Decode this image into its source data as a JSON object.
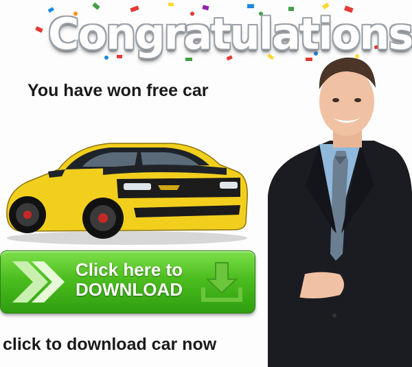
{
  "banner": {
    "title": "Congratulations!"
  },
  "headline": "You have won free car",
  "download_button": {
    "line1": "Click here to",
    "line2": "DOWNLOAD",
    "icon": "download-icon"
  },
  "footer": "click to download car now",
  "colors": {
    "button_green": "#4cbd1f",
    "car_yellow": "#f2cf1d",
    "text_dark": "#1a1a1a"
  }
}
